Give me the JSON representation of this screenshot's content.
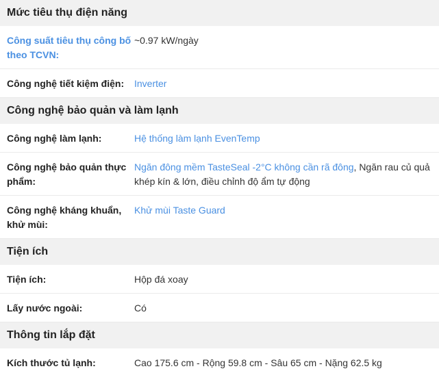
{
  "sections": [
    {
      "title": "Mức tiêu thụ điện năng",
      "rows": [
        {
          "label": "Công suất tiêu thụ công bố theo TCVN:",
          "value": "~0.97 kW/ngày"
        },
        {
          "label": "Công nghệ tiết kiệm điện:",
          "value_link": "Inverter"
        }
      ]
    },
    {
      "title": "Công nghệ bảo quản và làm lạnh",
      "rows": [
        {
          "label": "Công nghệ làm lạnh:",
          "value_link": "Hệ thống làm lạnh EvenTemp"
        },
        {
          "label": "Công nghệ bảo quản thực phẩm:",
          "value_link": "Ngăn đông mềm TasteSeal -2°C không cần rã đông",
          "value_rest": ", Ngăn rau củ quả khép kín & lớn, điều chỉnh độ ẩm tự động"
        },
        {
          "label": "Công nghệ kháng khuẩn, khử mùi:",
          "value_link": "Khử mùi Taste Guard"
        }
      ]
    },
    {
      "title": "Tiện ích",
      "rows": [
        {
          "label": "Tiện ích:",
          "value": "Hộp đá xoay"
        },
        {
          "label": "Lấy nước ngoài:",
          "value": "Có"
        }
      ]
    },
    {
      "title": "Thông tin lắp đặt",
      "rows": [
        {
          "label": "Kích thước tủ lạnh:",
          "value": "Cao 175.6 cm - Rộng 59.8 cm - Sâu 65 cm - Nặng 62.5 kg"
        }
      ]
    }
  ],
  "colors": {
    "link": "#4a90e2",
    "header_bg": "#f1f1f1",
    "divider": "#eaeaea"
  }
}
